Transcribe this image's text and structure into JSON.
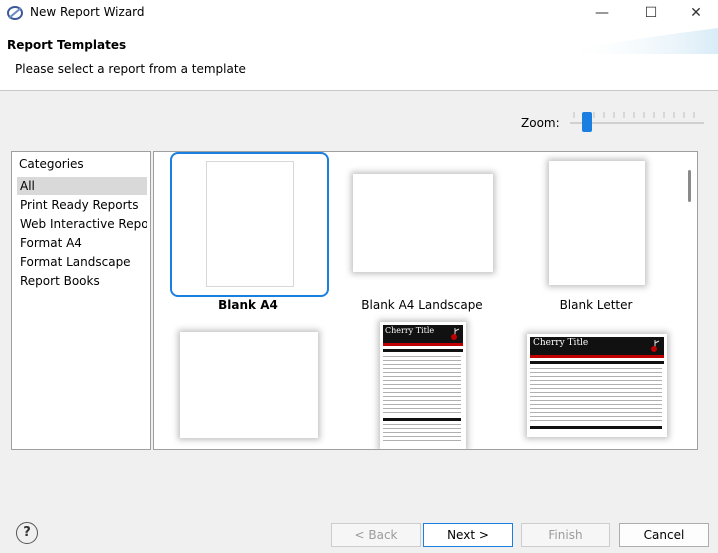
{
  "window": {
    "title": "New Report Wizard",
    "minimize_glyph": "—",
    "maximize_glyph": "☐",
    "close_glyph": "✕"
  },
  "header": {
    "title": "Report Templates",
    "subtitle": "Please select a report from a template"
  },
  "zoom": {
    "label": "Zoom:",
    "level": 0.1
  },
  "categories": {
    "header": "Categories",
    "items": [
      {
        "label": "All",
        "selected": true
      },
      {
        "label": "Print Ready Reports",
        "selected": false
      },
      {
        "label": "Web Interactive Reports",
        "selected": false
      },
      {
        "label": "Format A4",
        "selected": false
      },
      {
        "label": "Format Landscape",
        "selected": false
      },
      {
        "label": "Report Books",
        "selected": false
      }
    ]
  },
  "templates": [
    {
      "label": "Blank A4",
      "selected": true
    },
    {
      "label": "Blank A4 Landscape",
      "selected": false
    },
    {
      "label": "Blank Letter",
      "selected": false
    },
    {
      "label": "",
      "selected": false
    },
    {
      "label": "",
      "selected": false,
      "preview_title": "Cherry Title"
    },
    {
      "label": "",
      "selected": false,
      "preview_title": "Cherry Title"
    }
  ],
  "footer": {
    "help_glyph": "?",
    "back_label": "< Back",
    "next_label": "Next >",
    "finish_label": "Finish",
    "cancel_label": "Cancel"
  },
  "colors": {
    "accent": "#1a7fe0",
    "selection_bg": "#d9d9d9",
    "cherry_red": "#c00000",
    "cherry_black": "#111111"
  }
}
